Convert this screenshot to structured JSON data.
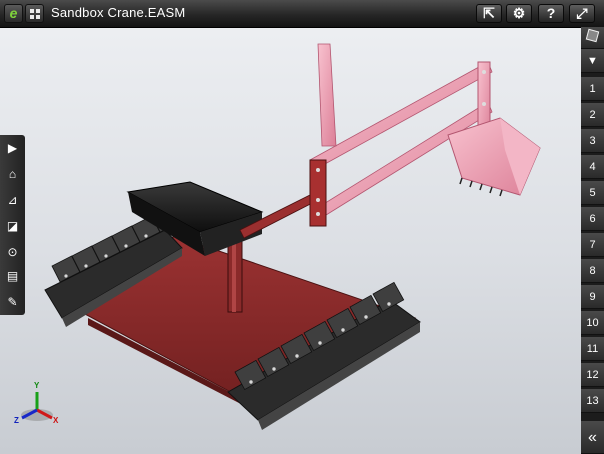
{
  "app": {
    "title": "Sandbox Crane.EASM",
    "logo_glyph": "e",
    "logo_icon": "edrawings-logo-icon",
    "grid_icon": "grid-menu-icon"
  },
  "toolbar_right": [
    {
      "icon": "share-icon",
      "glyph": "⇱"
    },
    {
      "icon": "gear-icon",
      "glyph": "⚙"
    },
    {
      "icon": "help-icon",
      "glyph": "?"
    },
    {
      "icon": "fullscreen-icon",
      "glyph": "⤢"
    }
  ],
  "left_toolbar": [
    {
      "icon": "play-icon",
      "glyph": "▶"
    },
    {
      "icon": "home-icon",
      "glyph": "⌂"
    },
    {
      "icon": "measure-icon",
      "glyph": "⊿"
    },
    {
      "icon": "section-icon",
      "glyph": "◪"
    },
    {
      "icon": "explode-icon",
      "glyph": "⊙"
    },
    {
      "icon": "components-icon",
      "glyph": "▤"
    },
    {
      "icon": "markup-pen-icon",
      "glyph": "✎"
    }
  ],
  "right_panel": {
    "cube_icon": "view-cube-icon",
    "dropdown_glyph": "▼",
    "views": [
      "1",
      "2",
      "3",
      "4",
      "5",
      "6",
      "7",
      "8",
      "9",
      "10",
      "11",
      "12",
      "13"
    ],
    "collapse_glyph": "«"
  },
  "triad": {
    "x": "X",
    "y": "Y",
    "z": "Z"
  },
  "colors": {
    "background_top": "#eef0f3",
    "crane_pink": "#f2a2b7",
    "base_red": "#8a2a2a",
    "seat_black": "#1a1a1a",
    "track_gray": "#3c3c3c"
  }
}
